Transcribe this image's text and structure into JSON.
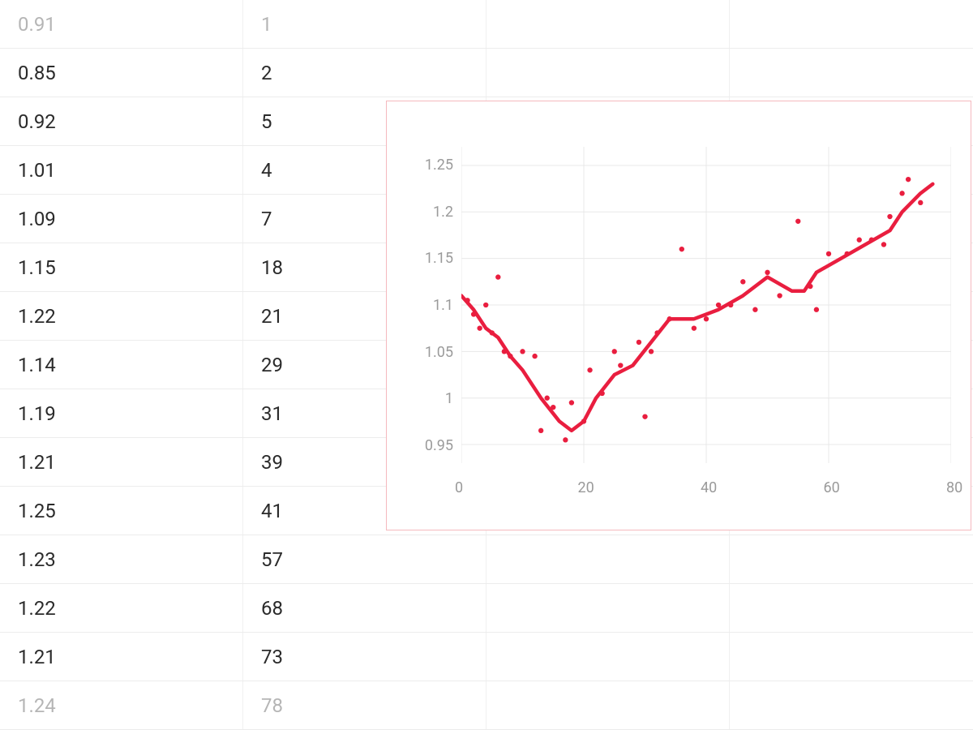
{
  "table": {
    "rows": [
      {
        "a": "0.91",
        "b": "1",
        "faded": true
      },
      {
        "a": "0.85",
        "b": "2",
        "faded": false
      },
      {
        "a": "0.92",
        "b": "5",
        "faded": false
      },
      {
        "a": "1.01",
        "b": "4",
        "faded": false
      },
      {
        "a": "1.09",
        "b": "7",
        "faded": false
      },
      {
        "a": "1.15",
        "b": "18",
        "faded": false
      },
      {
        "a": "1.22",
        "b": "21",
        "faded": false
      },
      {
        "a": "1.14",
        "b": "29",
        "faded": false
      },
      {
        "a": "1.19",
        "b": "31",
        "faded": false
      },
      {
        "a": "1.21",
        "b": "39",
        "faded": false
      },
      {
        "a": "1.25",
        "b": "41",
        "faded": false
      },
      {
        "a": "1.23",
        "b": "57",
        "faded": false
      },
      {
        "a": "1.22",
        "b": "68",
        "faded": false
      },
      {
        "a": "1.21",
        "b": "73",
        "faded": false
      },
      {
        "a": "1.24",
        "b": "78",
        "faded": true
      }
    ]
  },
  "chart_data": {
    "type": "scatter",
    "xlim": [
      0,
      80
    ],
    "ylim": [
      0.93,
      1.27
    ],
    "x_ticks": [
      0,
      20,
      40,
      60,
      80
    ],
    "y_ticks": [
      0.95,
      1,
      1.05,
      1.1,
      1.15,
      1.2,
      1.25
    ],
    "x_tick_labels": [
      "0",
      "20",
      "40",
      "60",
      "80"
    ],
    "y_tick_labels": [
      "0.95",
      "1",
      "1.05",
      "1.1",
      "1.15",
      "1.2",
      "1.25"
    ],
    "series": [
      {
        "name": "points",
        "kind": "scatter",
        "x": [
          1,
          2,
          3,
          4,
          5,
          6,
          7,
          8,
          10,
          12,
          13,
          14,
          15,
          17,
          18,
          20,
          21,
          23,
          25,
          26,
          29,
          30,
          31,
          32,
          34,
          36,
          38,
          40,
          42,
          44,
          46,
          48,
          50,
          52,
          55,
          57,
          58,
          60,
          63,
          65,
          67,
          69,
          70,
          72,
          73,
          75
        ],
        "y": [
          1.105,
          1.09,
          1.075,
          1.1,
          1.07,
          1.13,
          1.05,
          1.045,
          1.05,
          1.045,
          0.965,
          1.0,
          0.99,
          0.955,
          0.995,
          0.975,
          1.03,
          1.005,
          1.05,
          1.035,
          1.06,
          0.98,
          1.05,
          1.07,
          1.085,
          1.16,
          1.075,
          1.085,
          1.1,
          1.1,
          1.125,
          1.095,
          1.135,
          1.11,
          1.19,
          1.12,
          1.095,
          1.155,
          1.155,
          1.17,
          1.17,
          1.165,
          1.195,
          1.22,
          1.235,
          1.21
        ]
      },
      {
        "name": "trend",
        "kind": "line",
        "x": [
          0,
          2,
          4,
          6,
          8,
          10,
          13,
          16,
          18,
          20,
          22,
          25,
          28,
          31,
          34,
          38,
          42,
          46,
          50,
          54,
          56,
          58,
          62,
          66,
          70,
          72,
          75,
          77
        ],
        "y": [
          1.11,
          1.095,
          1.075,
          1.065,
          1.045,
          1.03,
          1.0,
          0.975,
          0.965,
          0.975,
          1.0,
          1.025,
          1.035,
          1.06,
          1.085,
          1.085,
          1.095,
          1.11,
          1.13,
          1.115,
          1.115,
          1.135,
          1.15,
          1.165,
          1.18,
          1.2,
          1.22,
          1.23
        ]
      }
    ],
    "accent": "#e91e3f",
    "title": "",
    "xlabel": "",
    "ylabel": ""
  }
}
